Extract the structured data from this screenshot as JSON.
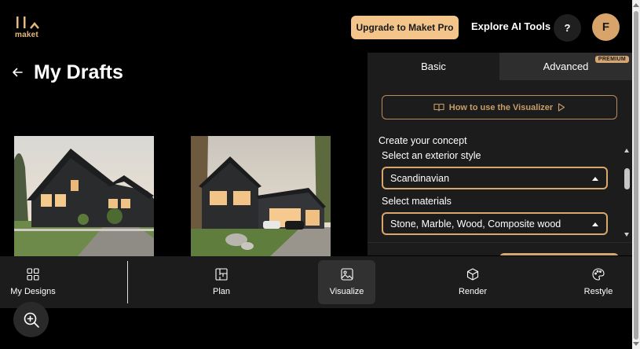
{
  "header": {
    "logo_text": "maket",
    "upgrade_label": "Upgrade to Maket Pro",
    "explore_label": "Explore AI Tools",
    "help_label": "?",
    "avatar_initial": "F"
  },
  "page": {
    "title": "My Drafts"
  },
  "drafts": [
    {
      "icon": "house-photo"
    },
    {
      "icon": "house-photo"
    }
  ],
  "panel": {
    "tabs": [
      {
        "label": "Basic",
        "active": true
      },
      {
        "label": "Advanced",
        "active": false,
        "badge": "PREMIUM"
      }
    ],
    "howto_label": "How to use the Visualizer",
    "concept_label": "Create your concept",
    "exterior_label": "Select an exterior style",
    "exterior_value": "Scandinavian",
    "materials_label": "Select materials",
    "materials_value": "Stone, Marble, Wood, Composite wood"
  },
  "bottom_nav": {
    "items": [
      {
        "label": "My Designs",
        "icon": "grid-icon"
      },
      {
        "label": "Plan",
        "icon": "floorplan-icon"
      },
      {
        "label": "Visualize",
        "icon": "image-icon",
        "active": true
      },
      {
        "label": "Render",
        "icon": "cube-icon"
      },
      {
        "label": "Restyle",
        "icon": "palette-icon"
      }
    ]
  },
  "colors": {
    "accent": "#f3c58a",
    "accent_border": "#d9a76b",
    "panel_bg": "#1c1c1c",
    "background": "#000000"
  }
}
